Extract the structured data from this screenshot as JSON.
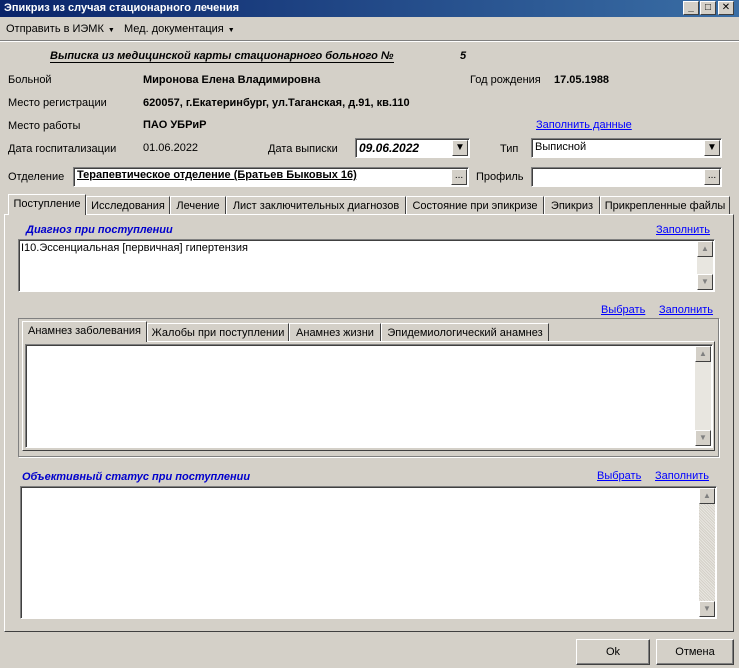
{
  "window": {
    "title": "Эпикриз из случая стационарного лечения",
    "min_glyph": "_",
    "max_glyph": "□",
    "close_glyph": "✕"
  },
  "menu": [
    {
      "label": "Отправить в ИЭМК",
      "arrow": "▼"
    },
    {
      "label": "Мед. документация",
      "arrow": "▼"
    }
  ],
  "header": {
    "title": "Выписка из медицинской карты стационарного больного №",
    "number": "5"
  },
  "patient": {
    "name_label": "Больной",
    "name": "Миронова Елена Владимировна",
    "birth_label": "Год рождения",
    "birth": "17.05.1988",
    "reg_label": "Место регистрации",
    "reg": "620057, г.Екатеринбург, ул.Таганская, д.91, кв.110",
    "work_label": "Место работы",
    "work": "ПАО УБРиР",
    "fill_link": "Заполнить данные",
    "hosp_label": "Дата госпитализации",
    "hosp_date": "01.06.2022",
    "discharge_label": "Дата выписки",
    "discharge_date": "09.06.2022",
    "type_label": "Тип",
    "type_value": "Выписной",
    "dept_label": "Отделение",
    "dept_value": "Терапевтическое отделение (Братьев Быковых 16)",
    "profile_label": "Профиль",
    "profile_value": "",
    "ellipsis": "...",
    "dropdown_arrow": "▼"
  },
  "tabs": [
    "Поступление",
    "Исследования",
    "Лечение",
    "Лист заключительных диагнозов",
    "Состояние при эпикризе",
    "Эпикриз",
    "Прикрепленные файлы"
  ],
  "diagnosis": {
    "title": "Диагноз при поступлении",
    "fill": "Заполнить",
    "text": "I10.Эссенциальная [первичная] гипертензия"
  },
  "anamnesis": {
    "select": "Выбрать",
    "fill": "Заполнить",
    "tabs": [
      "Анамнез заболевания",
      "Жалобы при поступлении",
      "Анамнез жизни",
      "Эпидемиологический анамнез"
    ],
    "text": ""
  },
  "objective": {
    "title": "Объективный статус при поступлении",
    "select": "Выбрать",
    "fill": "Заполнить",
    "text": ""
  },
  "scroll": {
    "up": "▲",
    "down": "▼"
  },
  "buttons": {
    "ok": "Ok",
    "cancel": "Отмена"
  }
}
